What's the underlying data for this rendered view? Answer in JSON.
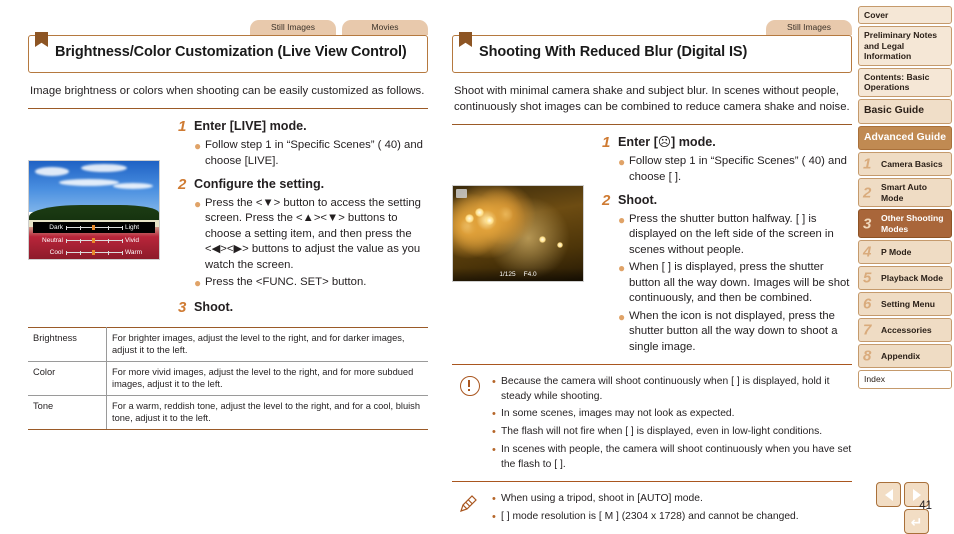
{
  "page": {
    "number": "41"
  },
  "left": {
    "tabs": [
      {
        "label": "Still Images"
      },
      {
        "label": "Movies"
      }
    ],
    "heading": "Brightness/Color Customization (Live View Control)",
    "intro": "Image brightness or colors when shooting can be easily customized as follows.",
    "steps": [
      {
        "num": "1",
        "title": "Enter [LIVE] mode.",
        "bullets": [
          "Follow step 1 in “Specific Scenes” ( 40) and choose [LIVE]."
        ]
      },
      {
        "num": "2",
        "title": "Configure the setting.",
        "bullets": [
          "Press the <▼> button to access the setting screen. Press the <▲><▼> buttons to choose a setting item, and then press the <◀><▶> buttons to adjust the value as you watch the screen.",
          "Press the <FUNC. SET> button."
        ]
      },
      {
        "num": "3",
        "title": "Shoot.",
        "bullets": []
      }
    ],
    "screen": {
      "rows": [
        {
          "left": "Dark",
          "right": "Light",
          "selected": true
        },
        {
          "left": "Neutral",
          "right": "Vivid",
          "selected": false
        },
        {
          "left": "Cool",
          "right": "Warm",
          "selected": false
        }
      ]
    },
    "table": [
      {
        "key": "Brightness",
        "value": "For brighter images, adjust the level to the right, and for darker images, adjust it to the left."
      },
      {
        "key": "Color",
        "value": "For more vivid images, adjust the level to the right, and for more subdued images, adjust it to the left."
      },
      {
        "key": "Tone",
        "value": "For a warm, reddish tone, adjust the level to the right, and for a cool, bluish tone, adjust it to the left."
      }
    ]
  },
  "right": {
    "tabs": [
      {
        "label": "Still Images"
      }
    ],
    "heading": "Shooting With Reduced Blur (Digital IS)",
    "intro": "Shoot with minimal camera shake and subject blur. In scenes without people, continuously shot images can be combined to reduce camera shake and noise.",
    "steps": [
      {
        "num": "1",
        "title": "Enter [☹] mode.",
        "bullets": [
          "Follow step 1 in “Specific Scenes” ( 40) and choose [ ]."
        ]
      },
      {
        "num": "2",
        "title": "Shoot.",
        "bullets": [
          "Press the shutter button halfway. [ ] is displayed on the left side of the screen in scenes without people.",
          "When [ ] is displayed, press the shutter button all the way down. Images will be shot continuously, and then be combined.",
          "When the icon is not displayed, press the shutter button all the way down to shoot a single image."
        ]
      }
    ],
    "screen": {
      "shutter": "1/125",
      "aperture": "F4.0"
    },
    "caution": [
      "Because the camera will shoot continuously when [ ] is displayed, hold it steady while shooting.",
      "In some scenes, images may not look as expected.",
      "The flash will not fire when [ ] is displayed, even in low-light conditions.",
      "In scenes with people, the camera will shoot continuously when you have set the flash to [ ]."
    ],
    "note": [
      "When using a tripod, shoot in [AUTO] mode.",
      "[ ] mode resolution is [ M ] (2304 x 1728) and cannot be changed."
    ]
  },
  "sidebar": {
    "items": [
      {
        "label": "Cover",
        "type": "plain"
      },
      {
        "label": "Preliminary Notes and Legal Information",
        "type": "plain"
      },
      {
        "label": "Contents: Basic Operations",
        "type": "plain"
      },
      {
        "label": "Basic Guide",
        "type": "big"
      },
      {
        "label": "Advanced Guide",
        "type": "section"
      },
      {
        "num": "1",
        "label": "Camera Basics",
        "type": "num"
      },
      {
        "num": "2",
        "label": "Smart Auto Mode",
        "type": "num"
      },
      {
        "num": "3",
        "label": "Other Shooting Modes",
        "type": "num",
        "active": true
      },
      {
        "num": "4",
        "label": "P Mode",
        "type": "num"
      },
      {
        "num": "5",
        "label": "Playback Mode",
        "type": "num"
      },
      {
        "num": "6",
        "label": "Setting Menu",
        "type": "num"
      },
      {
        "num": "7",
        "label": "Accessories",
        "type": "num"
      },
      {
        "num": "8",
        "label": "Appendix",
        "type": "num"
      },
      {
        "label": "Index",
        "type": "index"
      }
    ]
  },
  "nav": {
    "prev": "previous-page",
    "next": "next-page",
    "back": "return"
  },
  "colors": {
    "accent_brown": "#9a5a28",
    "tab_tan": "#e8c9ac",
    "step_orange": "#cf7b33",
    "sidebar_active": "#a9663a"
  }
}
